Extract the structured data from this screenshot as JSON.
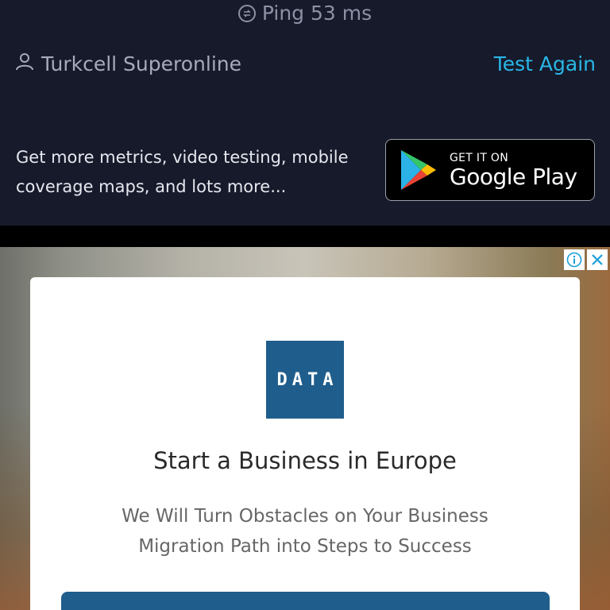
{
  "result": {
    "ping_label": "Ping 53 ms",
    "isp_name": "Turkcell Superonline",
    "test_again_label": "Test Again"
  },
  "promo": {
    "line1": "Get more metrics, video testing, mobile",
    "line2": "coverage maps, and lots more..."
  },
  "google_play": {
    "small": "GET IT ON",
    "big": "Google Play"
  },
  "ad": {
    "logo_text": "DATA",
    "title": "Start a Business in Europe",
    "subtitle_line1": "We Will Turn Obstacles on Your Business",
    "subtitle_line2": "Migration Path into Steps to Success",
    "info_icon": "info-icon",
    "close_icon": "close-icon",
    "brand_color": "#1f5d8c"
  },
  "colors": {
    "background": "#161a2b",
    "accent": "#29b7e6"
  }
}
